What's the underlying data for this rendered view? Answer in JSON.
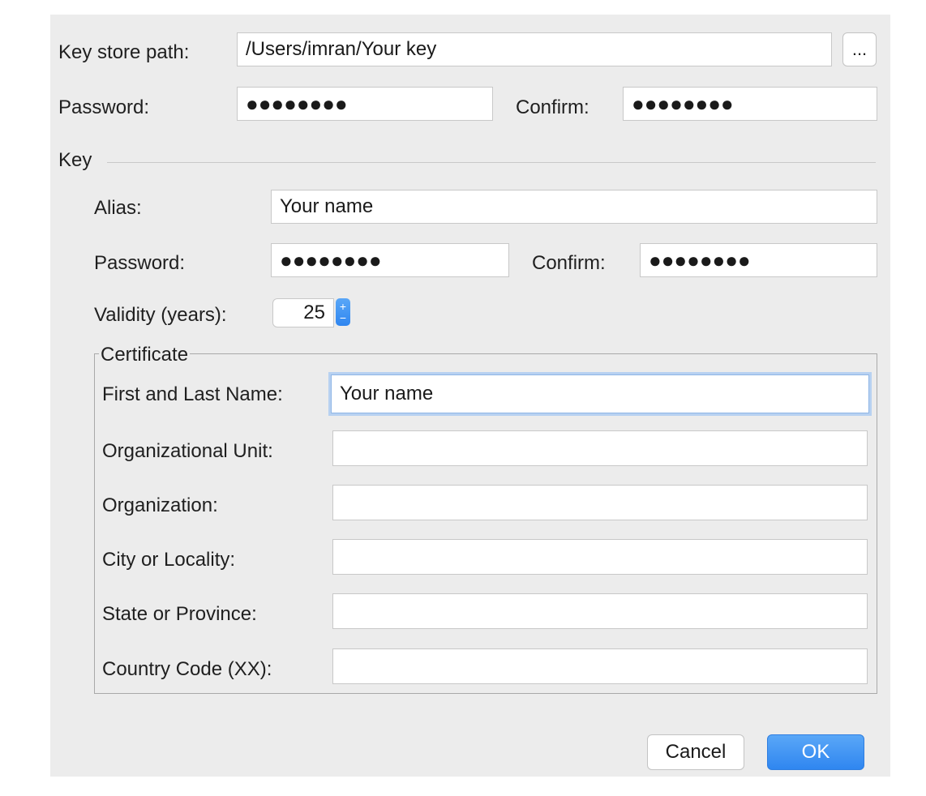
{
  "keystore": {
    "path_label": "Key store path:",
    "path_value": "/Users/imran/Your key",
    "browse_label": "...",
    "password_label": "Password:",
    "password_value": "●●●●●●●●",
    "confirm_label": "Confirm:",
    "confirm_value": "●●●●●●●●"
  },
  "key": {
    "section_label": "Key",
    "alias_label": "Alias:",
    "alias_value": "Your name",
    "password_label": "Password:",
    "password_value": "●●●●●●●●",
    "confirm_label": "Confirm:",
    "confirm_value": "●●●●●●●●",
    "validity_label": "Validity (years):",
    "validity_value": "25",
    "spinner_up": "+",
    "spinner_down": "−"
  },
  "certificate": {
    "title": "Certificate",
    "fields": [
      {
        "label": "First and Last Name:",
        "value": "Your name"
      },
      {
        "label": "Organizational Unit:",
        "value": ""
      },
      {
        "label": "Organization:",
        "value": ""
      },
      {
        "label": "City or Locality:",
        "value": ""
      },
      {
        "label": "State or Province:",
        "value": ""
      },
      {
        "label": "Country Code (XX):",
        "value": ""
      }
    ]
  },
  "buttons": {
    "cancel": "Cancel",
    "ok": "OK"
  },
  "colors": {
    "dialog_bg": "#ececec",
    "accent": "#2f86f0",
    "focus_ring": "#b7d1f1"
  }
}
